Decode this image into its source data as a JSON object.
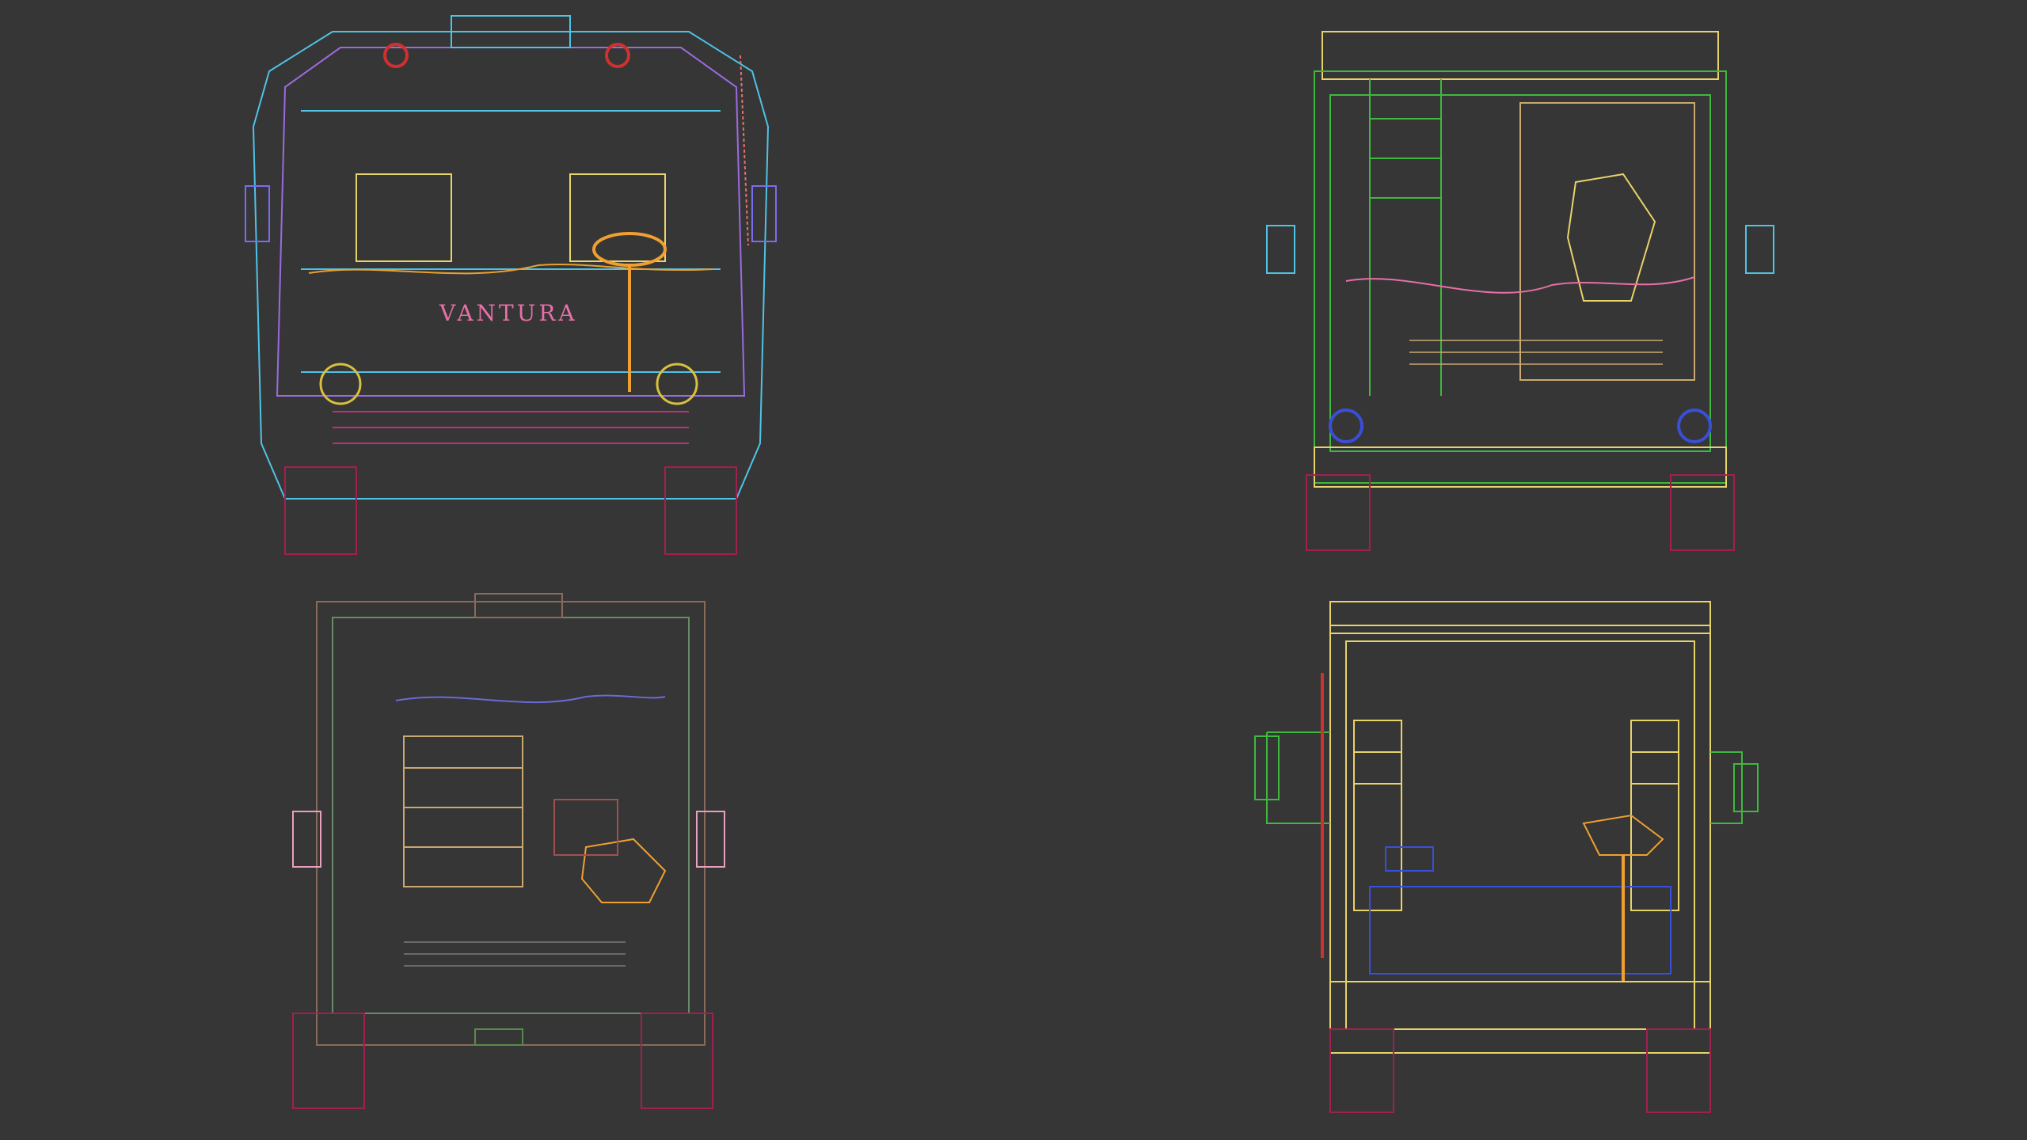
{
  "scene": {
    "background": "#363636",
    "brand_text": "VANTURA",
    "views": [
      {
        "id": "front-view",
        "label": ""
      },
      {
        "id": "rear-view-green",
        "label": ""
      },
      {
        "id": "front-view-faded",
        "label": ""
      },
      {
        "id": "rear-view-yellow",
        "label": ""
      }
    ]
  },
  "colors": {
    "cyan": "#4fc3e6",
    "purple": "#9b6be0",
    "yellow": "#e8d36a",
    "orange": "#f0a030",
    "magenta": "#c0307a",
    "green": "#3fb83f",
    "pink": "#e86fa8",
    "blue": "#3a4fd8",
    "red": "#d03030",
    "tan": "#c9a872"
  }
}
